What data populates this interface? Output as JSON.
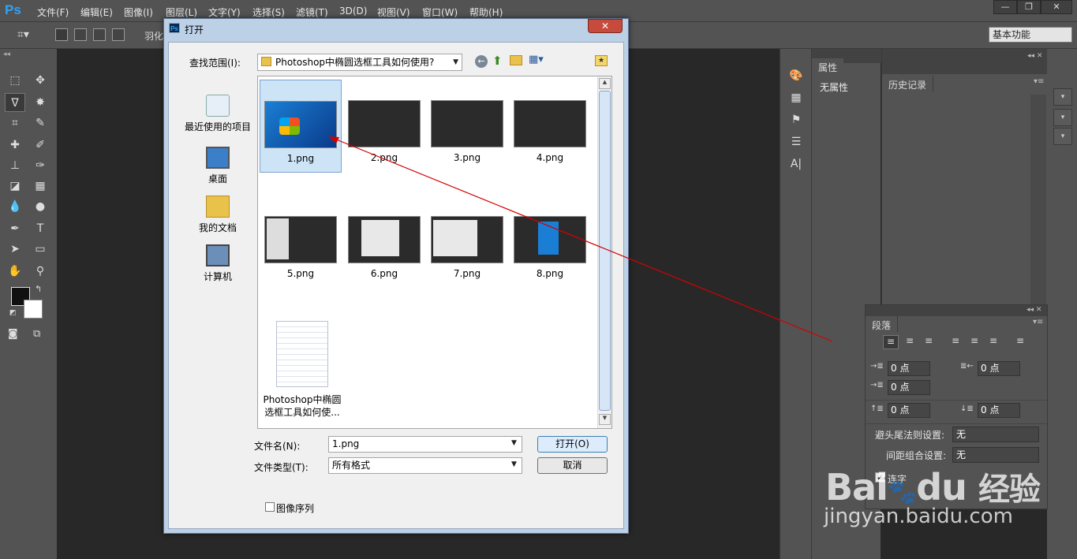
{
  "app": {
    "logo": "Ps"
  },
  "menu": [
    "文件(F)",
    "编辑(E)",
    "图像(I)",
    "图层(L)",
    "文字(Y)",
    "选择(S)",
    "滤镜(T)",
    "3D(D)",
    "视图(V)",
    "窗口(W)",
    "帮助(H)"
  ],
  "window_buttons": [
    "—",
    "❐",
    "✕"
  ],
  "options": {
    "feather_label": "羽化",
    "workspace": "基本功能"
  },
  "panels": {
    "properties_tab": "属性",
    "properties_text": "无属性",
    "history_tab": "历史记录",
    "paragraph_tab": "段落",
    "fields": [
      "0 点",
      "0 点",
      "0 点",
      "0 点",
      "0 点"
    ],
    "kinsoku_label": "避头尾法则设置:",
    "kinsoku_value": "无",
    "mojikumi_label": "间距组合设置:",
    "mojikumi_value": "无",
    "hyphen_label": "连字"
  },
  "dialog": {
    "title": "打开",
    "close": "✕",
    "lookin_label": "查找范围(I):",
    "lookin_value": "Photoshop中椭圆选框工具如何使用?",
    "places": [
      "最近使用的项目",
      "桌面",
      "我的文档",
      "计算机"
    ],
    "files": [
      "1.png",
      "2.png",
      "3.png",
      "4.png",
      "5.png",
      "6.png",
      "7.png",
      "8.png"
    ],
    "folder_name_line1": "Photoshop中椭圆",
    "folder_name_line2": "选框工具如何使...",
    "filename_label": "文件名(N):",
    "filename_value": "1.png",
    "filetype_label": "文件类型(T):",
    "filetype_value": "所有格式",
    "open_button": "打开(O)",
    "cancel_button": "取消",
    "sequence_label": "图像序列"
  },
  "watermark": {
    "brand": "Bai",
    "brand2": "du",
    "cn": "经验",
    "url": "jingyan.baidu.com"
  },
  "colors": {
    "accent": "#2fa3f8",
    "arrow": "#d40000",
    "ui_bg": "#535353",
    "dialog_frame": "#bcd0e6"
  }
}
